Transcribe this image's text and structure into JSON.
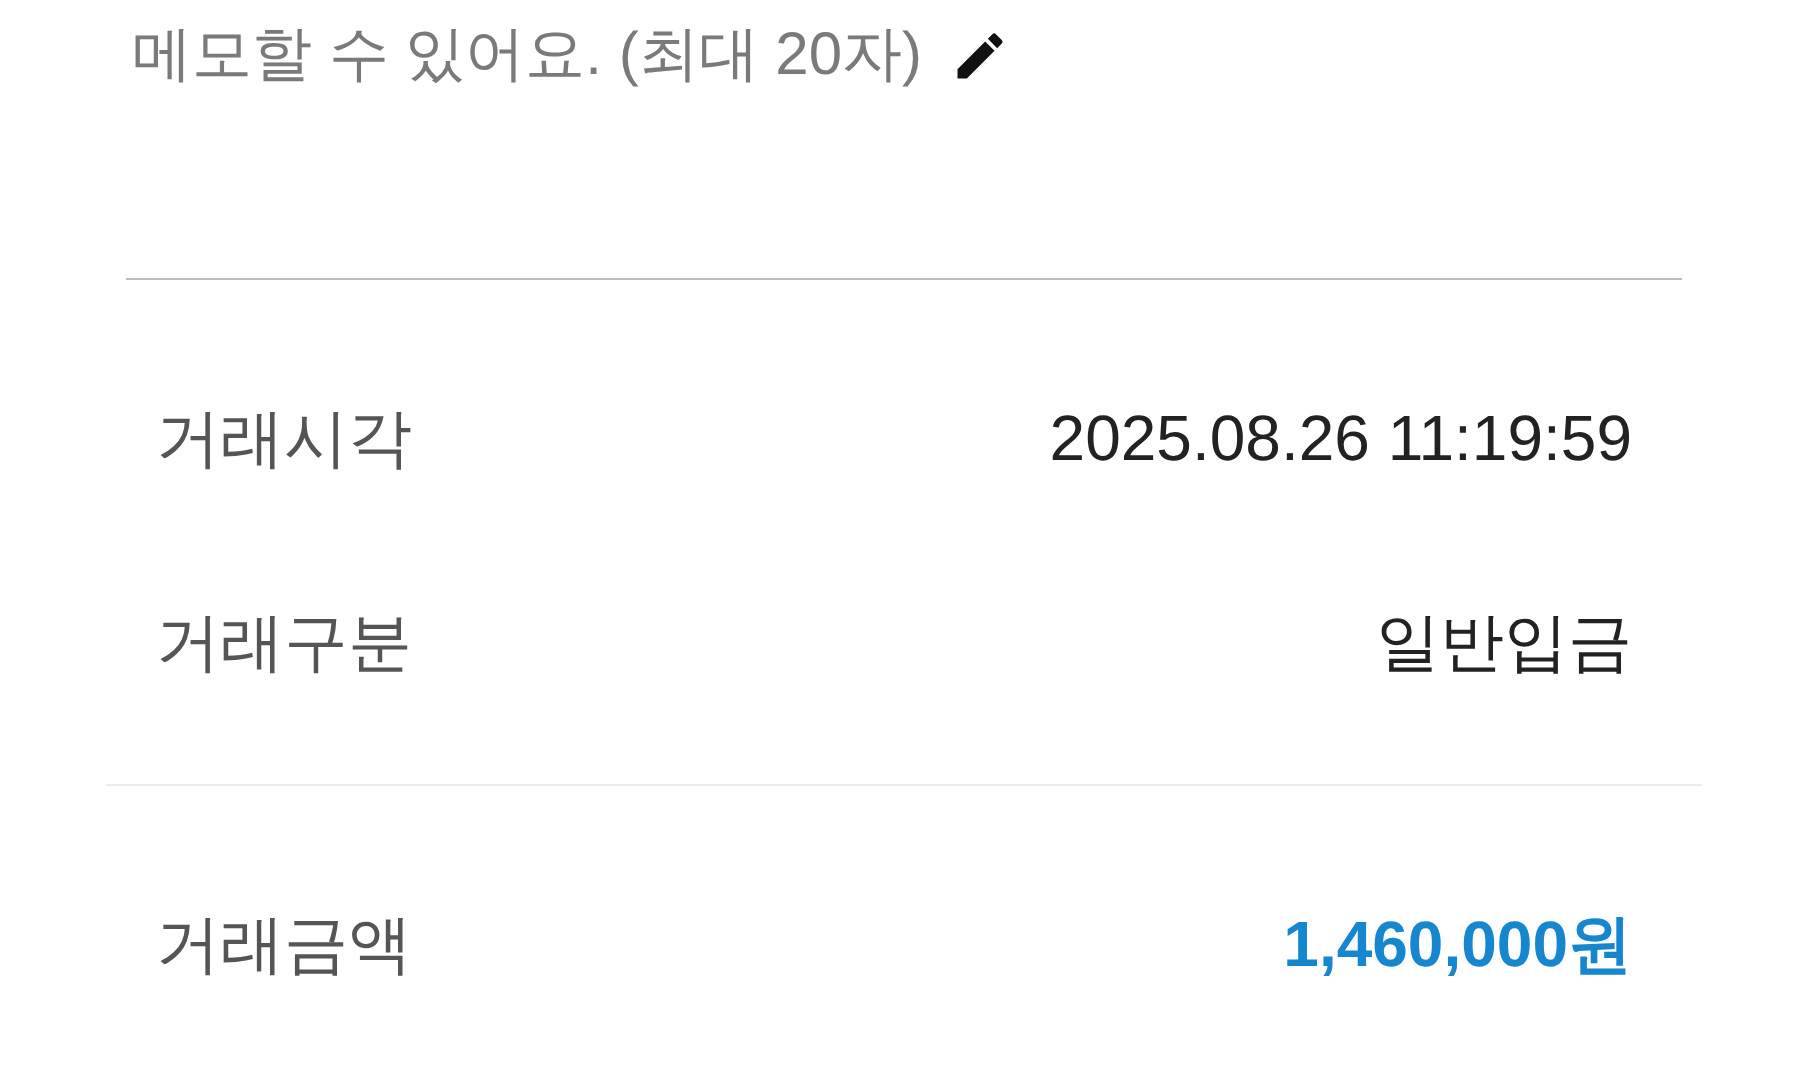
{
  "memo": {
    "placeholder": "메모할 수 있어요. (최대 20자)"
  },
  "details": [
    {
      "label": "거래시각",
      "value": "2025.08.26 11:19:59",
      "kind": "plain"
    },
    {
      "label": "거래구분",
      "value": "일반입금",
      "kind": "plain"
    }
  ],
  "amount": {
    "label": "거래금액",
    "value": "1,460,000원",
    "kind": "amount"
  }
}
